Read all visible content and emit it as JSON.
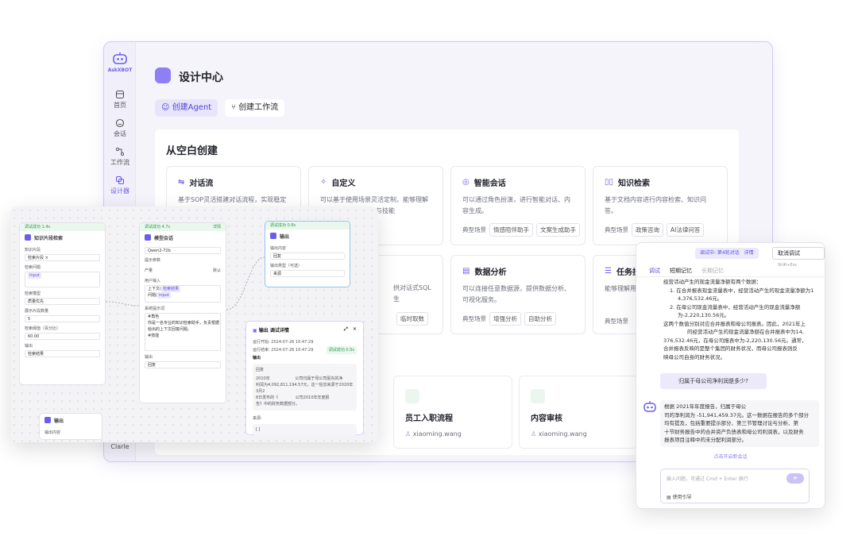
{
  "app": {
    "logo_text": "AskXBOT"
  },
  "nav": [
    {
      "label": "首页",
      "icon": "home-icon"
    },
    {
      "label": "会话",
      "icon": "chat-icon"
    },
    {
      "label": "工作流",
      "icon": "workflow-icon"
    },
    {
      "label": "设计器",
      "icon": "designer-icon"
    }
  ],
  "user_partial": "Clarle",
  "page_title": "设计中心",
  "tabs": [
    {
      "label": "创建Agent"
    },
    {
      "label": "创建工作流"
    }
  ],
  "section_title": "从空白创建",
  "cards": [
    {
      "title": "对话流",
      "desc": "基于SOP灵活搭建对话流程，实现稳定"
    },
    {
      "title": "自定义",
      "desc": "可以基于使用场景灵活定制，能够理解",
      "desc2": "并使用工具与技能"
    },
    {
      "title": "智能会话",
      "desc": "可以通过角色扮演，进行智能对话、内容生成。",
      "tags_label": "典型场景",
      "tags": [
        "情感陪伴助手",
        "文案生成助手"
      ]
    },
    {
      "title": "知识检索",
      "desc": "基于文档内容进行内容检索、知识问答。",
      "tags_label": "典型场景",
      "tags": [
        "政策咨询",
        "AI法律问答"
      ]
    },
    {
      "title": "",
      "desc": "拱对话式SQL生",
      "tags": [
        "临时取数"
      ]
    },
    {
      "title": "数据分析",
      "desc": "可以连接任意数据源，提供数据分析、可视化服务。",
      "tags_label": "典型场景",
      "tags": [
        "增强分析",
        "自助分析"
      ]
    },
    {
      "title": "任务拆",
      "desc": "能够理解用户意图，完成任务分解、任",
      "tags_label": "典型场景"
    }
  ],
  "workflow_cards": [
    {
      "title": "员工入职流程",
      "user": "xiaoming.wang"
    },
    {
      "title": "内容审核",
      "user": "xiaoming.wang"
    }
  ],
  "workflow": {
    "node1": {
      "status": "调试成功 1.4s",
      "title": "知识片段检索",
      "l1": "知识片段",
      "v1": "检索片段 ×",
      "l2": "检索问题",
      "chip": "input",
      "l3": "检索模型",
      "v3": "质量优先",
      "l4": "展示片段数量",
      "v4": "5",
      "l5": "检索阈值（百分比）",
      "v5": "60.00",
      "l6": "输出",
      "v6": "检索结果"
    },
    "node2": {
      "status": "调试成功 4.7s",
      "status_right": "详情",
      "title": "模型会话",
      "v1": "Qwen2-72b",
      "l2": "提示参数",
      "l3": "产量",
      "l3r": "默认",
      "l4": "用户输入",
      "t4a": "上下文(",
      "chip4a": "检索结果",
      "t4b": "问题(",
      "chip4b": "input",
      "l5": "系统提示词",
      "t5a": "#角色",
      "t5b": "你是一名专业的知识检索助手，负责根据",
      "t5c": "给出的上下文回答问题。",
      "t5d": "#技能",
      "l6": "输出",
      "v6": "回复"
    },
    "node3": {
      "status": "调试成功 0.8s",
      "title": "输出",
      "l1": "输出内容",
      "v1": "回复",
      "l2": "输出类型（可选）",
      "v2": "来源"
    },
    "node4": {
      "title": "输出",
      "l1": "输出内容"
    },
    "modal": {
      "title": "输出 调试详情",
      "start_label": "运行开始:",
      "start": "2024-07-26 10:47:29",
      "end_label": "运行结束:",
      "end": "2024-07-26 10:47:29",
      "badge": "调试成功 0.0s",
      "out_label": "输出",
      "reply_label": "回复",
      "reply_l1": "2010年",
      "reply_l2": "公司归属于母公司股东的净",
      "reply_l3": "利润为4,092,811,194.57元，这一信息来源于2020年3月2",
      "reply_l4": "8日发布的《",
      "reply_l5": "公司2010年年度报",
      "reply_l6": "告》中的财务数据部分。",
      "source_label": "来源:",
      "source_val": "[ ]"
    }
  },
  "debug": {
    "badge": "调试中: 第4轮对话",
    "badge_link": "详情",
    "stop_label": "取消调试",
    "stop_hint": "Shift+Esc",
    "tabs": [
      "调试",
      "短期记忆",
      "长期记忆"
    ],
    "lines": [
      "经营活动产生的现金流量净额有两个数据：",
      "1. 在合并报表现金流量表中，经营活动产生的现金流量净额为1",
      "4,376,532.46元。",
      "2. 在母公司现金流量表中，经营活动产生的现金流量净额",
      "为-2,220,130.56元。",
      "这两个数值分别对应合并报表和母公司报表。因此，2021年上",
      "的经营活动产生的现金流量净额在合并报表中为14,",
      "376,532.46元，在母公司报表中为-2,220,130.56元。通常，",
      "合并报表反映的是整个集团的财务状况，而母公司报表则反",
      "映母公司自身的财务状况。"
    ],
    "question": "归属于母公司净利润是多少?",
    "answer": [
      "根据 2021年年度报告，归属于母公",
      "司的净利润为 -51,941,459.37元。这一数据在报告的多个部分",
      "均有提及，包括重要提示部分、第三节管理讨论与分析、第",
      "十节财务报告中的合并资产负债表和母公司利润表，以及财务",
      "报表项目注释中的未分配利润部分。"
    ],
    "new_session": "点击开启新会话",
    "input_placeholder": "输入问题，可通过 Cmd + Enter 换行",
    "guide": "使用引导"
  },
  "colors": {
    "accent": "#6b5ee8",
    "accent_light": "#ece9fb",
    "success": "#2a9d4a"
  }
}
